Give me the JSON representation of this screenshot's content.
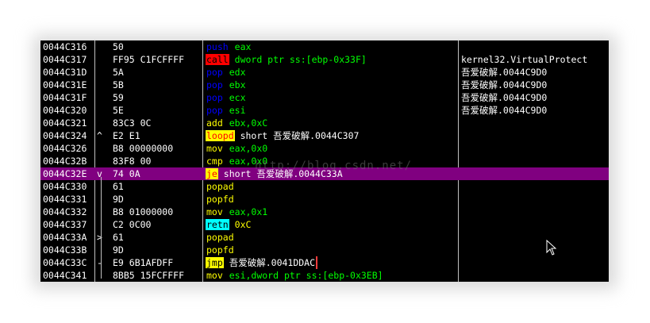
{
  "watermark": "http://blog.csdn.net/",
  "colors": {
    "background": "#000000",
    "selected_row": "#800080",
    "highlight_box": "#ff3b3b"
  },
  "rows": [
    {
      "addr": "0044C316",
      "mark": "",
      "hex": "50",
      "mnem": "push",
      "ops": "eax",
      "comment": ""
    },
    {
      "addr": "0044C317",
      "mark": "",
      "hex": "FF95 C1FCFFFF",
      "mnem": "call",
      "ops": "dword ptr ss:[ebp-0x33F]",
      "comment": "kernel32.VirtualProtect"
    },
    {
      "addr": "0044C31D",
      "mark": "",
      "hex": "5A",
      "mnem": "pop",
      "ops": "edx",
      "comment": "吾爱破解.0044C9D0"
    },
    {
      "addr": "0044C31E",
      "mark": "",
      "hex": "5B",
      "mnem": "pop",
      "ops": "ebx",
      "comment": "吾爱破解.0044C9D0"
    },
    {
      "addr": "0044C31F",
      "mark": "",
      "hex": "59",
      "mnem": "pop",
      "ops": "ecx",
      "comment": "吾爱破解.0044C9D0"
    },
    {
      "addr": "0044C320",
      "mark": "",
      "hex": "5E",
      "mnem": "pop",
      "ops": "esi",
      "comment": "吾爱破解.0044C9D0"
    },
    {
      "addr": "0044C321",
      "mark": "",
      "hex": "83C3 0C",
      "mnem": "add",
      "ops": "ebx,0xC",
      "comment": ""
    },
    {
      "addr": "0044C324",
      "mark": "^",
      "hex": "E2 E1",
      "mnem": "loopd",
      "ops": "short 吾爱破解.0044C307",
      "comment": ""
    },
    {
      "addr": "0044C326",
      "mark": "",
      "hex": "B8 00000000",
      "mnem": "mov",
      "ops": "eax,0x0",
      "comment": ""
    },
    {
      "addr": "0044C32B",
      "mark": "",
      "hex": "83F8 00",
      "mnem": "cmp",
      "ops": "eax,0x0",
      "comment": ""
    },
    {
      "addr": "0044C32E",
      "mark": "v",
      "hex": "74 0A",
      "mnem": "je",
      "ops": "short 吾爱破解.0044C33A",
      "comment": ""
    },
    {
      "addr": "0044C330",
      "mark": "",
      "hex": "61",
      "mnem": "popad",
      "ops": "",
      "comment": ""
    },
    {
      "addr": "0044C331",
      "mark": "",
      "hex": "9D",
      "mnem": "popfd",
      "ops": "",
      "comment": ""
    },
    {
      "addr": "0044C332",
      "mark": "",
      "hex": "B8 01000000",
      "mnem": "mov",
      "ops": "eax,0x1",
      "comment": ""
    },
    {
      "addr": "0044C337",
      "mark": "",
      "hex": "C2 0C00",
      "mnem": "retn",
      "ops": "0xC",
      "comment": ""
    },
    {
      "addr": "0044C33A",
      "mark": ">",
      "hex": "61",
      "mnem": "popad",
      "ops": "",
      "comment": ""
    },
    {
      "addr": "0044C33B",
      "mark": "",
      "hex": "9D",
      "mnem": "popfd",
      "ops": "",
      "comment": ""
    },
    {
      "addr": "0044C33C",
      "mark": "-",
      "hex": "E9 6B1AFDFF",
      "mnem": "jmp",
      "ops": "吾爱破解.0041DDAC",
      "comment": ""
    },
    {
      "addr": "0044C341",
      "mark": "",
      "hex": "8BB5 15FCFFFF",
      "mnem": "mov",
      "ops": "esi,dword ptr ss:[ebp-0x3EB]",
      "comment": ""
    }
  ],
  "selected_index": 10,
  "boxed_index": 17
}
